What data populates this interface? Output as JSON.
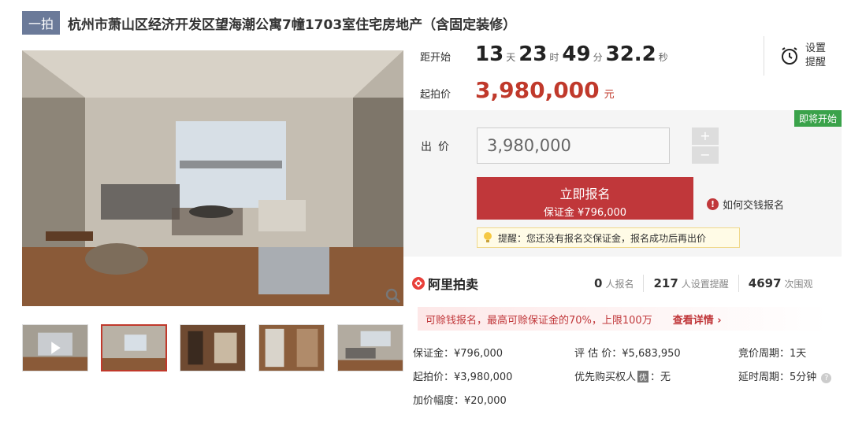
{
  "header": {
    "tag": "一拍",
    "title": "杭州市萧山区经济开发区望海潮公寓7幢1703室住宅房地产（含固定装修）"
  },
  "countdown": {
    "label": "距开始",
    "days": "13",
    "days_unit": "天",
    "hours": "23",
    "hours_unit": "时",
    "minutes": "49",
    "minutes_unit": "分",
    "seconds": "32.2",
    "seconds_unit": "秒"
  },
  "reminder": {
    "label": "设置提醒"
  },
  "start_price": {
    "label": "起拍价",
    "value": "3,980,000",
    "unit": "元"
  },
  "bid": {
    "status": "即将开始",
    "label": "出价",
    "input_value": "3,980,000",
    "plus": "+",
    "minus": "−",
    "signup_label": "立即报名",
    "signup_deposit": "保证金 ¥796,000",
    "howto": "如何交钱报名",
    "notice": "提醒：您还没有报名交保证金，报名成功后再出价"
  },
  "stats": {
    "brand": "阿里拍卖",
    "signups": "0",
    "signups_label": "人报名",
    "reminders": "217",
    "reminders_label": "人设置提醒",
    "views": "4697",
    "views_label": "次围观"
  },
  "promo": {
    "text": "可赊钱报名，最高可赊保证金的70%，上限100万",
    "link": "查看详情 ›"
  },
  "details": {
    "deposit": "保证金：¥796,000",
    "appraisal": "评 估 价：¥5,683,950",
    "cycle": "竞价周期：1天",
    "start": "起拍价：¥3,980,000",
    "priority_prefix": "优先购买权人",
    "priority_badge": "优",
    "priority_suffix": "：无",
    "delay": "延时周期：5分钟",
    "increment": "加价幅度：¥20,000"
  },
  "colors": {
    "accent": "#c0373a",
    "status_green": "#3aa24a",
    "tag_bg": "#6b7a99"
  },
  "icons": [
    "zoom-icon",
    "alarm-clock-icon",
    "info-icon",
    "lightbulb-icon",
    "brand-logo-icon",
    "help-icon"
  ]
}
